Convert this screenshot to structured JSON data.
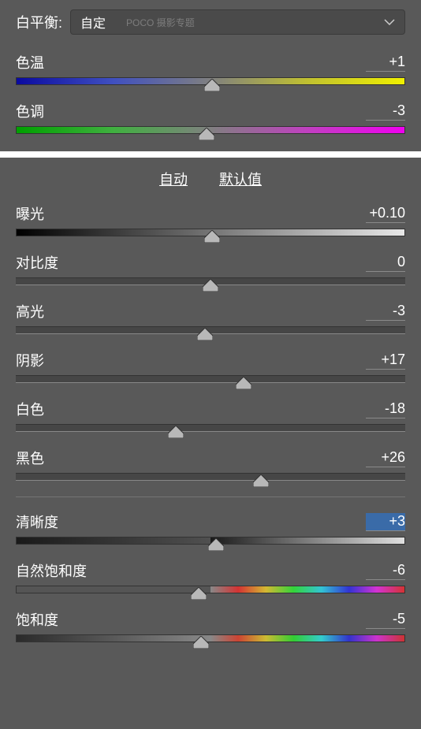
{
  "whiteBalance": {
    "label": "白平衡:",
    "selected": "自定",
    "watermark": "POCO 摄影专题"
  },
  "temp": {
    "label": "色温",
    "value": "+1",
    "pos": 50.5
  },
  "tint": {
    "label": "色调",
    "value": "-3",
    "pos": 49
  },
  "links": {
    "auto": "自动",
    "default": "默认值"
  },
  "exposure": {
    "label": "曝光",
    "value": "+0.10",
    "pos": 50.5
  },
  "contrast": {
    "label": "对比度",
    "value": "0",
    "pos": 50
  },
  "highlights": {
    "label": "高光",
    "value": "-3",
    "pos": 48.5
  },
  "shadows": {
    "label": "阴影",
    "value": "+17",
    "pos": 58.5
  },
  "whites": {
    "label": "白色",
    "value": "-18",
    "pos": 41
  },
  "blacks": {
    "label": "黑色",
    "value": "+26",
    "pos": 63
  },
  "clarity": {
    "label": "清晰度",
    "value": "+3",
    "pos": 51.5
  },
  "vibrance": {
    "label": "自然饱和度",
    "value": "-6",
    "pos": 47
  },
  "saturation": {
    "label": "饱和度",
    "value": "-5",
    "pos": 47.5
  }
}
